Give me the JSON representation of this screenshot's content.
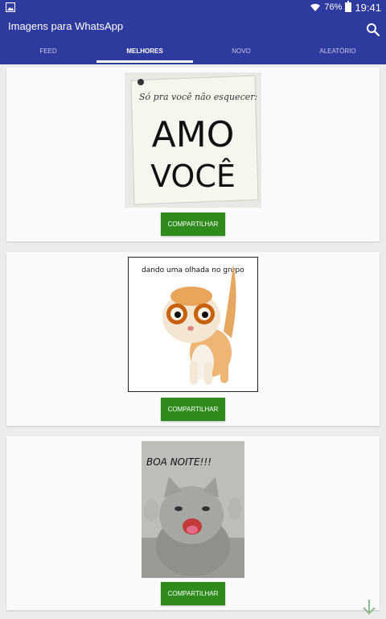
{
  "status_bar": {
    "battery": "76%",
    "time": "19:41",
    "icons": [
      "gallery-icon",
      "wifi-icon",
      "battery-icon"
    ]
  },
  "app": {
    "title": "Imagens para WhatsApp",
    "search_icon": "search-icon"
  },
  "tabs": [
    {
      "label": "FEED",
      "active": false
    },
    {
      "label": "MELHORES",
      "active": true
    },
    {
      "label": "NOVO",
      "active": false
    },
    {
      "label": "ALEATÓRIO",
      "active": false
    }
  ],
  "posts": [
    {
      "image_lines": [
        "Só pra você não esquecer:",
        "AMO",
        "VOCÊ"
      ],
      "share_label": "COMPARTILHAR"
    },
    {
      "image_caption": "dando uma olhada no grupo",
      "share_label": "COMPARTILHAR"
    },
    {
      "image_caption": "BOA NOITE!!!",
      "share_label": "COMPARTILHAR"
    }
  ],
  "colors": {
    "primary": "#2f3a9f",
    "button": "#2e8b1c",
    "background": "#ececec"
  }
}
